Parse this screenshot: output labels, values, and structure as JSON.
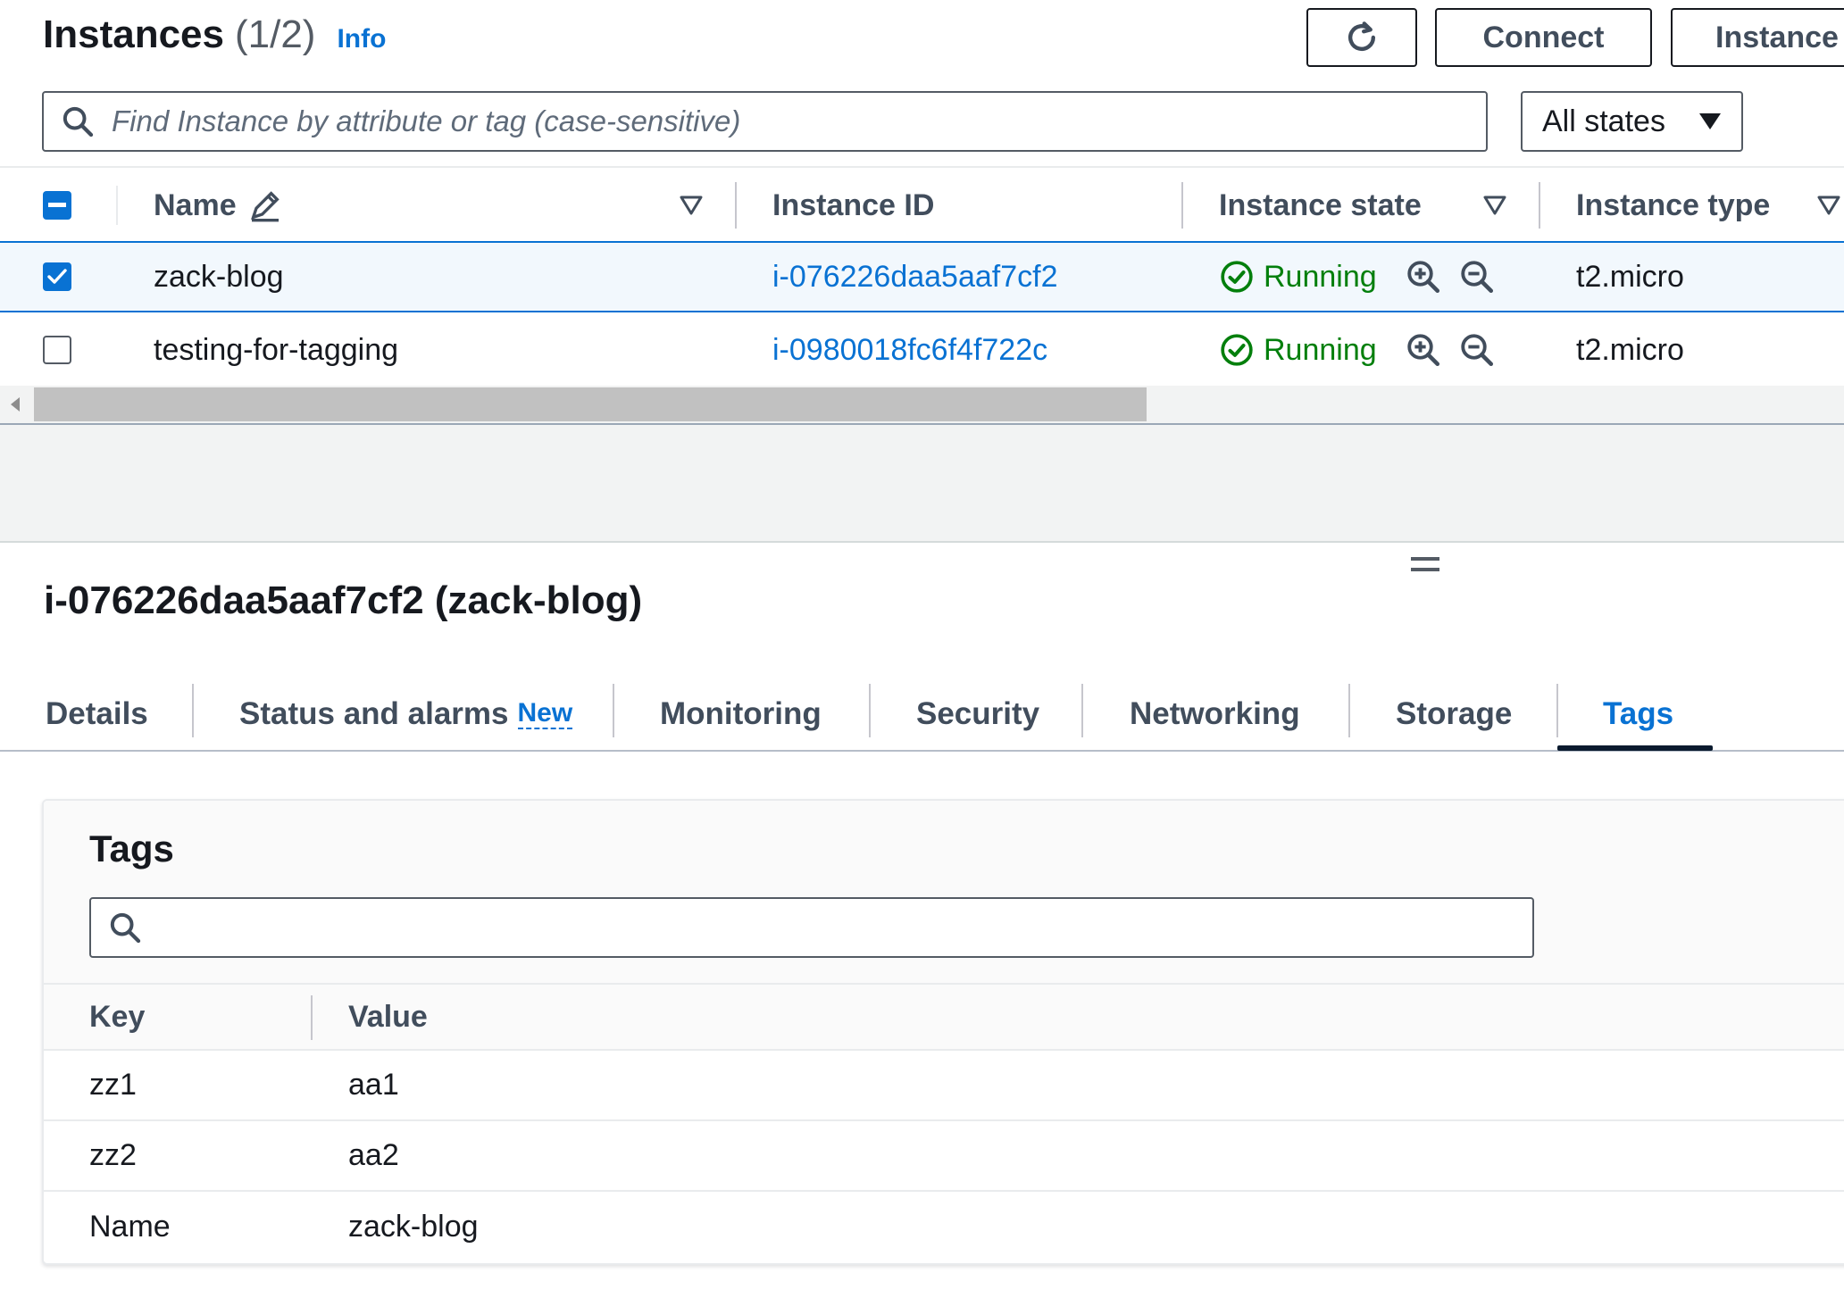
{
  "header": {
    "title": "Instances",
    "count": "(1/2)",
    "info_label": "Info",
    "refresh_icon": "refresh-icon",
    "connect_label": "Connect",
    "instance_state_label": "Instance state"
  },
  "filter": {
    "search_placeholder": "Find Instance by attribute or tag (case-sensitive)",
    "states_value": "All states"
  },
  "table": {
    "columns": {
      "name": "Name",
      "instance_id": "Instance ID",
      "instance_state": "Instance state",
      "instance_type": "Instance type"
    },
    "rows": [
      {
        "selected": true,
        "name": "zack-blog",
        "instance_id": "i-076226daa5aaf7cf2",
        "state": "Running",
        "type": "t2.micro"
      },
      {
        "selected": false,
        "name": "testing-for-tagging",
        "instance_id": "i-0980018fc6f4f722c",
        "state": "Running",
        "type": "t2.micro"
      }
    ]
  },
  "detail": {
    "title": "i-076226daa5aaf7cf2 (zack-blog)",
    "tabs": [
      {
        "label": "Details"
      },
      {
        "label": "Status and alarms",
        "badge": "New"
      },
      {
        "label": "Monitoring"
      },
      {
        "label": "Security"
      },
      {
        "label": "Networking"
      },
      {
        "label": "Storage"
      },
      {
        "label": "Tags"
      }
    ],
    "active_tab": "Tags",
    "tags_panel": {
      "title": "Tags",
      "search_placeholder": "",
      "columns": {
        "key": "Key",
        "value": "Value"
      },
      "rows": [
        {
          "key": "zz1",
          "value": "aa1"
        },
        {
          "key": "zz2",
          "value": "aa2"
        },
        {
          "key": "Name",
          "value": "zack-blog"
        }
      ]
    }
  },
  "colors": {
    "link": "#0972d3",
    "running": "#037f0c",
    "selected_row_bg": "#f2f8fd",
    "text": "#16191f"
  }
}
